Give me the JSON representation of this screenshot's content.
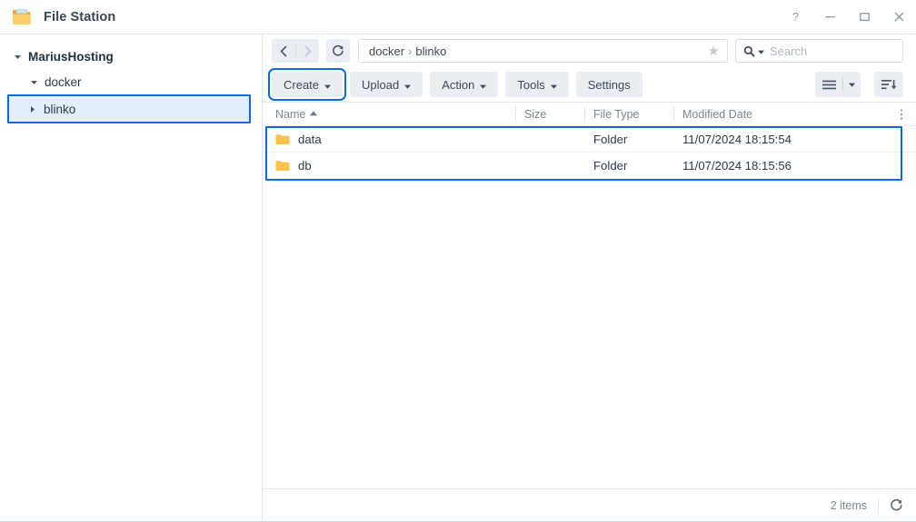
{
  "window": {
    "title": "File Station",
    "icon": "folder-open-icon",
    "controls": [
      {
        "name": "help-button",
        "glyph": "?"
      },
      {
        "name": "minimize-button",
        "glyph": "–"
      },
      {
        "name": "maximize-button",
        "glyph": "□"
      },
      {
        "name": "close-button",
        "glyph": "✕"
      }
    ]
  },
  "sidebar": {
    "items": [
      {
        "label": "MariusHosting",
        "level": 0,
        "expanded": true,
        "arrow": "chevron-down-icon",
        "selected": false
      },
      {
        "label": "docker",
        "level": 1,
        "expanded": true,
        "arrow": "chevron-down-icon",
        "selected": false
      },
      {
        "label": "blinko",
        "level": 2,
        "expanded": false,
        "arrow": "chevron-right-icon",
        "selected": true
      }
    ]
  },
  "navbar": {
    "back_label": "‹",
    "forward_label": "›",
    "refresh_label": "refresh-icon",
    "breadcrumb": {
      "parts": [
        "docker",
        "blinko"
      ],
      "separator": "›"
    },
    "favorite_label": "★"
  },
  "search": {
    "placeholder": "Search",
    "value": "",
    "icon": "magnifier-icon"
  },
  "toolbar": {
    "create_label": "Create",
    "upload_label": "Upload",
    "action_label": "Action",
    "tools_label": "Tools",
    "settings_label": "Settings",
    "caret": "▾",
    "view_mode_icon": "list-view-icon",
    "view_caret": "▾",
    "sort_icon": "sort-descending-icon",
    "highlighted_button": "Create"
  },
  "filelist": {
    "columns": [
      {
        "key": "name",
        "label": "Name",
        "sort": "asc",
        "sort_glyph": "▲"
      },
      {
        "key": "size",
        "label": "Size"
      },
      {
        "key": "type",
        "label": "File Type"
      },
      {
        "key": "date",
        "label": "Modified Date"
      }
    ],
    "column_menu_icon": "more-options-icon",
    "rows": [
      {
        "icon": "folder-icon",
        "name": "data",
        "size": "",
        "type": "Folder",
        "date": "11/07/2024 18:15:54"
      },
      {
        "icon": "folder-icon",
        "name": "db",
        "size": "",
        "type": "Folder",
        "date": "11/07/2024 18:15:56"
      }
    ],
    "selection_highlight": true
  },
  "statusbar": {
    "count_label": "2 items",
    "refresh_icon": "refresh-icon"
  },
  "colors": {
    "accent_highlight": "#0b6ae4",
    "selection_fill": "#e4eefc",
    "button_bg": "#eaeef3",
    "folder_yellow": "#fcc24c",
    "text": "#2e3a47",
    "muted_text": "#7c8793"
  }
}
